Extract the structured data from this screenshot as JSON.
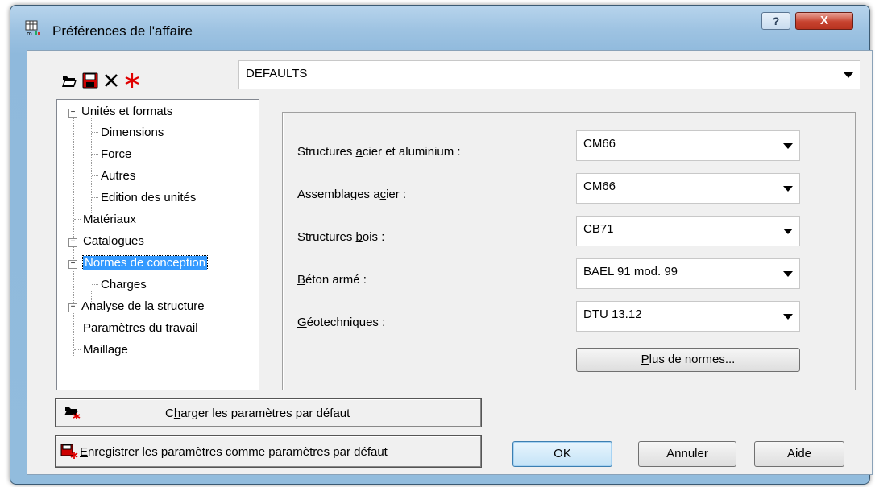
{
  "window": {
    "title": "Préférences de l'affaire",
    "help_label": "?",
    "close_label": "X"
  },
  "profile": {
    "selected": "DEFAULTS"
  },
  "tree": {
    "items": [
      {
        "label": "Unités et formats",
        "expander": "−"
      },
      {
        "label": "Dimensions"
      },
      {
        "label": "Force"
      },
      {
        "label": "Autres"
      },
      {
        "label": "Edition des unités"
      },
      {
        "label": "Matériaux"
      },
      {
        "label": "Catalogues",
        "expander": "+"
      },
      {
        "label": "Normes de conception",
        "expander": "−"
      },
      {
        "label": "Charges"
      },
      {
        "label": "Analyse de la structure",
        "expander": "+"
      },
      {
        "label": "Paramètres du travail"
      },
      {
        "label": "Maillage"
      }
    ]
  },
  "norms": {
    "fields": [
      {
        "label_pre": "Structures ",
        "label_u": "a",
        "label_post": "cier et aluminium :",
        "value": "CM66"
      },
      {
        "label_pre": "Assemblages a",
        "label_u": "c",
        "label_post": "ier :",
        "value": "CM66"
      },
      {
        "label_pre": "Structures ",
        "label_u": "b",
        "label_post": "ois :",
        "value": "CB71"
      },
      {
        "label_pre": "",
        "label_u": "B",
        "label_post": "éton armé :",
        "value": "BAEL 91 mod. 99"
      },
      {
        "label_pre": "",
        "label_u": "G",
        "label_post": "éotechniques :",
        "value": "DTU 13.12"
      }
    ],
    "more_pre": "",
    "more_u": "P",
    "more_post": "lus de normes..."
  },
  "buttons": {
    "load_defaults_pre": "C",
    "load_defaults_u": "h",
    "load_defaults_post": "arger les paramètres par défaut",
    "save_defaults_u": "E",
    "save_defaults_post": "nregistrer les paramètres comme paramètres par défaut",
    "ok": "OK",
    "cancel": "Annuler",
    "help": "Aide"
  },
  "colors": {
    "selection": "#3399ff",
    "close_button": "#c7432f",
    "title_gradient": "#9ec3e2"
  }
}
